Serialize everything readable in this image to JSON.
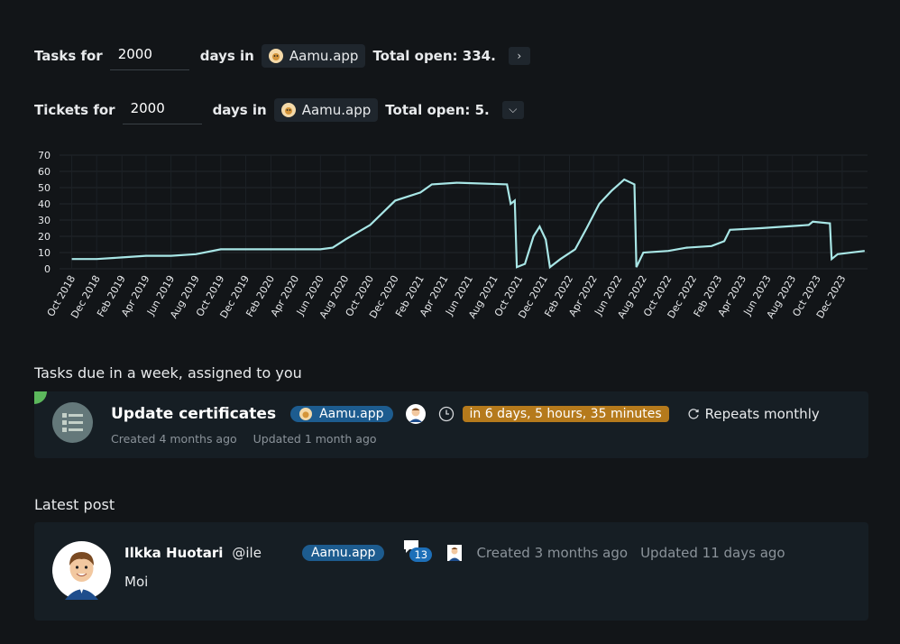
{
  "tasks_row": {
    "label": "Tasks for",
    "days_value": "2000",
    "days_in": "days in",
    "workspace": "Aamu.app",
    "total": "Total open: 334."
  },
  "tickets_row": {
    "label": "Tickets for",
    "days_value": "2000",
    "days_in": "days in",
    "workspace": "Aamu.app",
    "total": "Total open: 5."
  },
  "chart_data": {
    "type": "line",
    "ylim": [
      0,
      70
    ],
    "yticks": [
      "0",
      "10",
      "20",
      "30",
      "40",
      "50",
      "60",
      "70"
    ],
    "xticks": [
      "Oct 2018",
      "Dec 2018",
      "Feb 2019",
      "Apr 2019",
      "Jun 2019",
      "Aug 2019",
      "Oct 2019",
      "Dec 2019",
      "Feb 2020",
      "Apr 2020",
      "Jun 2020",
      "Aug 2020",
      "Oct 2020",
      "Dec 2020",
      "Feb 2021",
      "Apr 2021",
      "Jun 2021",
      "Aug 2021",
      "Oct 2021",
      "Dec 2021",
      "Feb 2022",
      "Apr 2022",
      "Jun 2022",
      "Aug 2022",
      "Oct 2022",
      "Dec 2022",
      "Feb 2023",
      "Apr 2023",
      "Jun 2023",
      "Aug 2023",
      "Oct 2023",
      "Dec 2023"
    ],
    "series": [
      {
        "color": "#a8e6e6",
        "points": [
          [
            "2018-10-01",
            6
          ],
          [
            "2018-12-01",
            6
          ],
          [
            "2019-02-01",
            7
          ],
          [
            "2019-04-01",
            8
          ],
          [
            "2019-06-01",
            8
          ],
          [
            "2019-08-01",
            9
          ],
          [
            "2019-10-01",
            12
          ],
          [
            "2019-12-01",
            12
          ],
          [
            "2020-02-01",
            12
          ],
          [
            "2020-04-01",
            12
          ],
          [
            "2020-06-01",
            12
          ],
          [
            "2020-07-01",
            13
          ],
          [
            "2020-08-01",
            18
          ],
          [
            "2020-10-01",
            27
          ],
          [
            "2020-12-01",
            42
          ],
          [
            "2021-02-01",
            47
          ],
          [
            "2021-03-01",
            52
          ],
          [
            "2021-05-01",
            53
          ],
          [
            "2021-09-01",
            52
          ],
          [
            "2021-09-10",
            40
          ],
          [
            "2021-09-20",
            42
          ],
          [
            "2021-09-25",
            1
          ],
          [
            "2021-10-15",
            3
          ],
          [
            "2021-11-05",
            20
          ],
          [
            "2021-11-20",
            26
          ],
          [
            "2021-12-05",
            18
          ],
          [
            "2021-12-15",
            1
          ],
          [
            "2022-01-10",
            6
          ],
          [
            "2022-02-15",
            12
          ],
          [
            "2022-03-15",
            25
          ],
          [
            "2022-04-15",
            40
          ],
          [
            "2022-05-15",
            48
          ],
          [
            "2022-06-15",
            55
          ],
          [
            "2022-07-10",
            52
          ],
          [
            "2022-07-15",
            1
          ],
          [
            "2022-08-01",
            10
          ],
          [
            "2022-10-01",
            11
          ],
          [
            "2022-11-15",
            13
          ],
          [
            "2023-01-15",
            14
          ],
          [
            "2023-02-15",
            17
          ],
          [
            "2023-03-01",
            24
          ],
          [
            "2023-05-15",
            25
          ],
          [
            "2023-09-10",
            27
          ],
          [
            "2023-09-20",
            29
          ],
          [
            "2023-11-01",
            28
          ],
          [
            "2023-11-05",
            6
          ],
          [
            "2023-11-20",
            9
          ],
          [
            "2024-01-25",
            11
          ]
        ]
      }
    ]
  },
  "tasks_due": {
    "section_title": "Tasks due in a week, assigned to you",
    "task_title": "Update certificates",
    "workspace": "Aamu.app",
    "due": "in 6 days, 5 hours, 35 minutes",
    "repeats": "Repeats monthly",
    "created": "Created 4 months ago",
    "updated": "Updated 1 month ago"
  },
  "latest_post": {
    "section_title": "Latest post",
    "author": "Ilkka Huotari",
    "handle": "@ile",
    "workspace": "Aamu.app",
    "comments": "13",
    "created": "Created 3 months ago",
    "updated": "Updated 11 days ago",
    "body": "Moi"
  },
  "colors": {
    "accent_line": "#a8e6e6",
    "badge_blue": "#1d5c8f",
    "badge_orange": "#b57a1c",
    "card_bg": "#161e24",
    "page_bg": "#121518",
    "corner_green": "#5cb85c"
  }
}
